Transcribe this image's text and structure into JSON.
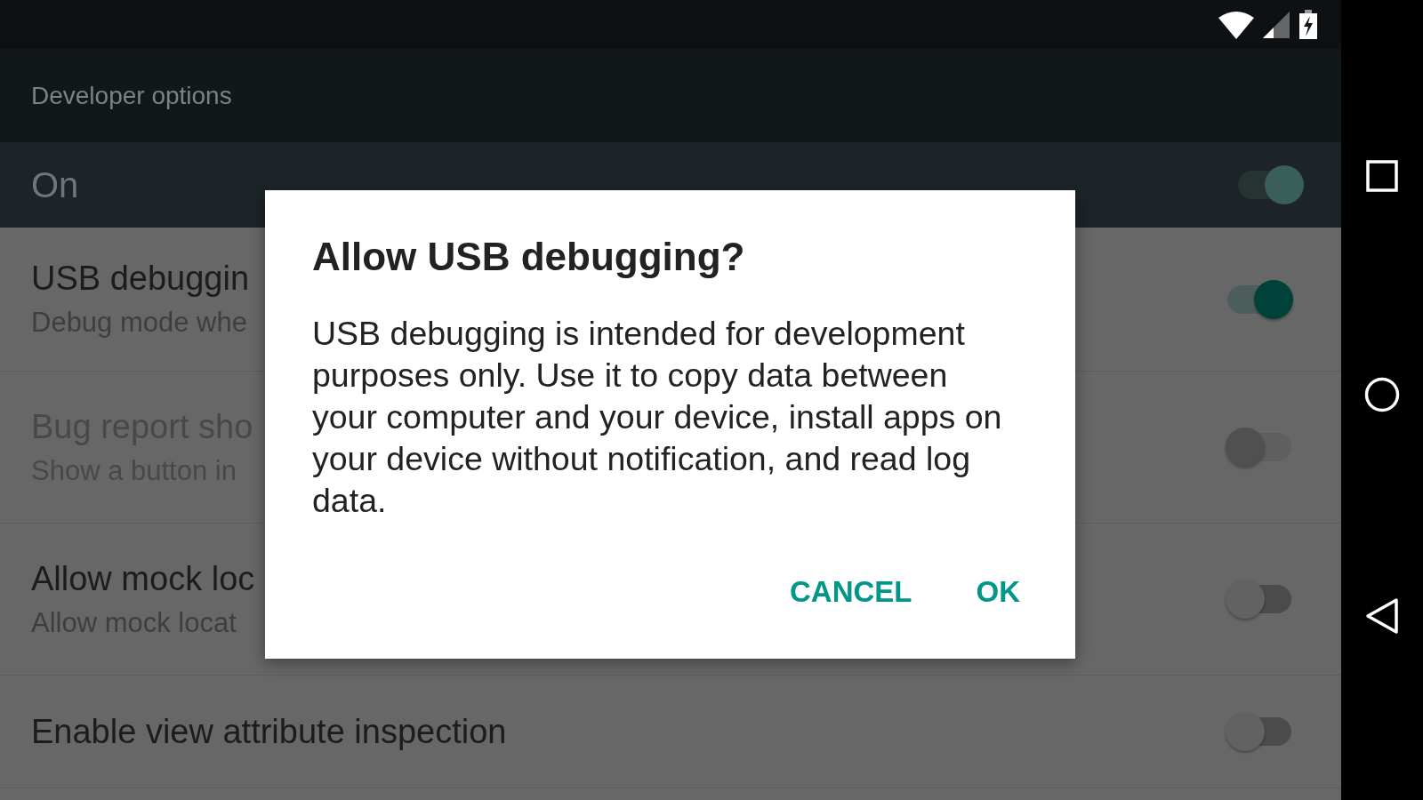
{
  "app_bar": {
    "title": "Developer options"
  },
  "master_switch": {
    "label": "On",
    "on": true
  },
  "settings": [
    {
      "title": "USB debuggin",
      "subtitle": "Debug mode whe",
      "on": true,
      "disabled": false
    },
    {
      "title": "Bug report sho",
      "subtitle": "Show a button in",
      "on": false,
      "disabled": true
    },
    {
      "title": "Allow mock loc",
      "subtitle": "Allow mock locat",
      "on": false,
      "disabled": false
    },
    {
      "title": "Enable view attribute inspection",
      "on": false,
      "disabled": false
    }
  ],
  "dialog": {
    "title": "Allow USB debugging?",
    "message": "USB debugging is intended for development purposes only. Use it to copy data between your computer and your device, install apps on your device without notification, and read log data.",
    "buttons": [
      {
        "label": "CANCEL"
      },
      {
        "label": "OK"
      }
    ]
  }
}
